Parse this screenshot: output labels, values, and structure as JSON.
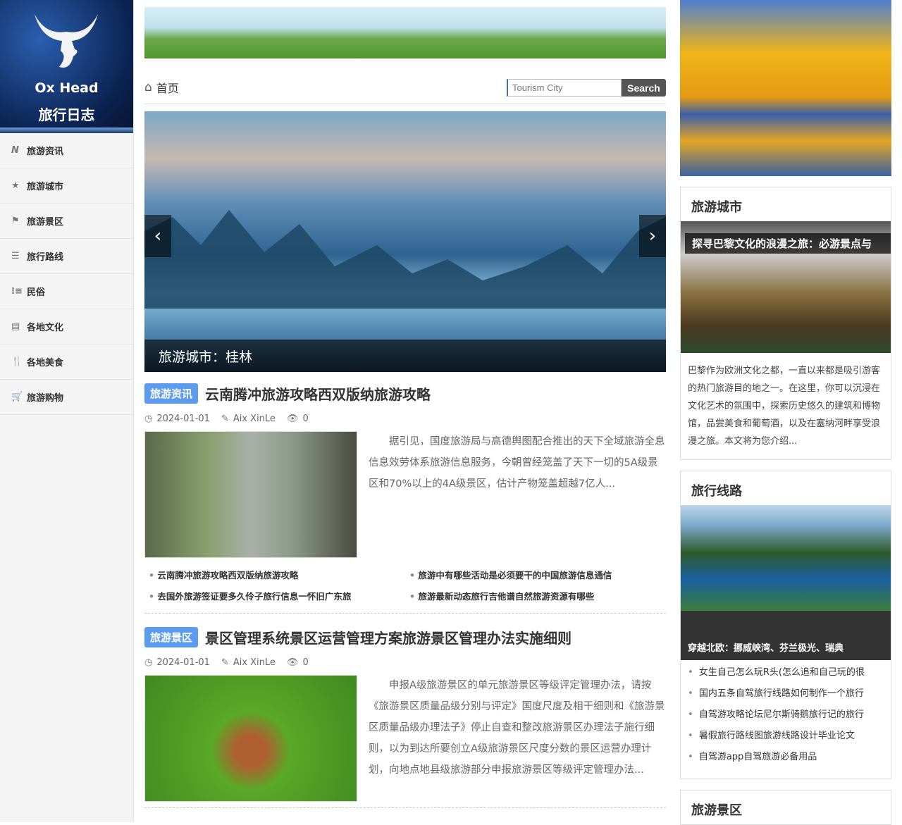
{
  "brand": {
    "name_en": "Ox Head",
    "name_cn": "旅行日志"
  },
  "nav": [
    {
      "label": "旅游资讯",
      "icon": "news-icon"
    },
    {
      "label": "旅游城市",
      "icon": "star-icon"
    },
    {
      "label": "旅游景区",
      "icon": "flag-icon"
    },
    {
      "label": "旅行路线",
      "icon": "list-icon"
    },
    {
      "label": "民俗",
      "icon": "list-bullet-icon"
    },
    {
      "label": "各地文化",
      "icon": "book-icon"
    },
    {
      "label": "各地美食",
      "icon": "cutlery-icon"
    },
    {
      "label": "旅游购物",
      "icon": "cart-icon"
    }
  ],
  "breadcrumb": {
    "home": "首页"
  },
  "search": {
    "placeholder": "Tourism City",
    "button": "Search"
  },
  "slider": {
    "caption": "旅游城市：桂林",
    "prev": "‹",
    "next": "›"
  },
  "articles": [
    {
      "tag": "旅游资讯",
      "title": "云南腾冲旅游攻略西双版纳旅游攻略",
      "date": "2024-01-01",
      "author": "Aix XinLe",
      "views": "0",
      "excerpt": "据引见，国度旅游局与高德舆图配合推出的天下全域旅游全息信息效劳体系旅游信息服务，今朝曾经笼盖了天下一切的5A级景区和70%以上的4A级景区，估计产物笼盖超越7亿人...",
      "links": [
        "云南腾冲旅游攻略西双版纳旅游攻略",
        "旅游中有哪些活动是必须要干的中国旅游信息通信",
        "去国外旅游签证要多久伶子旅行信息一怀旧广东旅",
        "旅游最新动态旅行吉他谱自然旅游资源有哪些"
      ]
    },
    {
      "tag": "旅游景区",
      "title": "景区管理系统景区运营管理方案旅游景区管理办法实施细则",
      "date": "2024-01-01",
      "author": "Aix XinLe",
      "views": "0",
      "excerpt": "申报A级旅游景区的单元旅游景区等级评定管理办法，请按《旅游景区质量品级分别与评定》国度尺度及相干细则和《旅游景区质量品级办理法子》停止自查和整改旅游景区办理法子施行细则，以为到达所要创立A级旅游景区尺度分数的景区运营办理计划，向地点地县级旅游部分申报旅游景区等级评定管理办法..."
    }
  ],
  "right": {
    "city": {
      "title": "旅游城市",
      "overlay": "探寻巴黎文化的浪漫之旅：必游景点与",
      "text": "巴黎作为欧洲文化之都，一直以来都是吸引游客的热门旅游目的地之一。在这里，你可以沉浸在文化艺术的氛围中，探索历史悠久的建筑和博物馆，品尝美食和葡萄酒，以及在塞纳河畔享受浪漫之旅。本文将为您介绍..."
    },
    "route": {
      "title": "旅行线路",
      "caption": "穿越北欧：挪威峡湾、芬兰极光、瑞典",
      "items": [
        "女生自己怎么玩R头(怎么追和自己玩的很",
        "国内五条自驾旅行线路如何制作一个旅行",
        "自驾游攻略论坛尼尔斯骑鹅旅行记的旅行",
        "暑假旅行路线图旅游线路设计毕业论文",
        "自驾游app自驾旅游必备用品"
      ]
    },
    "scenic": {
      "title": "旅游景区"
    }
  }
}
